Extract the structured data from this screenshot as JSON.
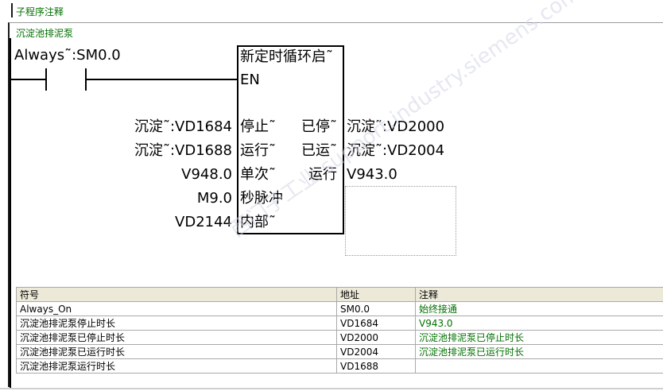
{
  "subroutine_comment": "子程序注释",
  "network_comment": "沉淀池排泥泵",
  "contact": {
    "label": "Always˜:SM0.0"
  },
  "block": {
    "title": "新定时循环启˜",
    "en": "EN",
    "inputs": [
      {
        "operand": "沉淀˜:VD1684",
        "pin": "停止˜"
      },
      {
        "operand": "沉淀˜:VD1688",
        "pin": "运行˜"
      },
      {
        "operand": "V948.0",
        "pin": "单次˜"
      },
      {
        "operand": "M9.0",
        "pin": "秒脉冲"
      },
      {
        "operand": "VD2144",
        "pin": "内部˜"
      }
    ],
    "outputs": [
      {
        "pin": "已停˜",
        "operand": "沉淀˜:VD2000"
      },
      {
        "pin": "已运˜",
        "operand": "沉淀˜:VD2004"
      },
      {
        "pin": "运行",
        "operand": "V943.0"
      }
    ]
  },
  "watermark": "西门子工业 support.industry.siemens.com/cs",
  "symbol_table": {
    "headers": [
      "符号",
      "地址",
      "注释"
    ],
    "rows": [
      [
        "Always_On",
        "SM0.0",
        "始终接通"
      ],
      [
        "沉淀池排泥泵停止时长",
        "VD1684",
        "V943.0"
      ],
      [
        "沉淀池排泥泵已停止时长",
        "VD2000",
        "沉淀池排泥泵已停止时长"
      ],
      [
        "沉淀池排泥泵已运行时长",
        "VD2004",
        "沉淀池排泥泵已运行时长"
      ],
      [
        "沉淀池排泥泵运行时长",
        "VD1688",
        ""
      ]
    ]
  }
}
